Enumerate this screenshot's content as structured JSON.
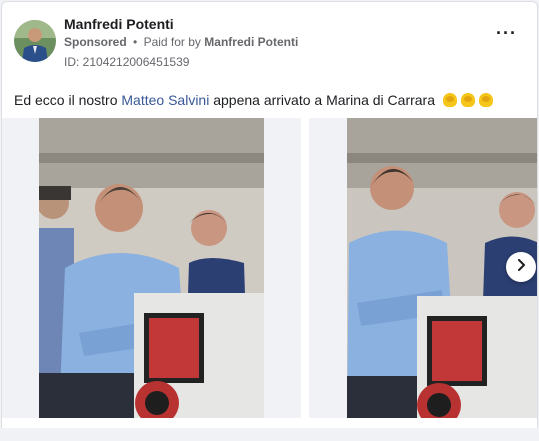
{
  "post": {
    "author": "Manfredi Potenti",
    "sponsored": "Sponsored",
    "dot": "•",
    "paid_for_by": "Paid for by",
    "payer": "Manfredi Potenti",
    "ad_id": "ID: 2104212006451539",
    "more_label": "···",
    "caption_before": "Ed ecco il nostro ",
    "caption_mention": "Matteo Salvini",
    "caption_after": " appena arrivato a Marina di Carrara",
    "emoji": "flexed-biceps",
    "emoji_count": 3
  },
  "icons": {
    "more": "more-dots-icon",
    "next": "chevron-right-icon"
  },
  "colors": {
    "link": "#385898",
    "meta": "#65676b",
    "background": "#f0f2f5"
  }
}
